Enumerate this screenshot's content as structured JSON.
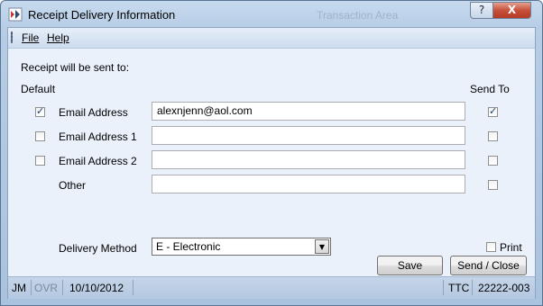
{
  "window": {
    "title": "Receipt Delivery Information",
    "background_title": "Transaction Area",
    "help_button": "?",
    "close_button": "X"
  },
  "menu": {
    "file": "File",
    "help": "Help"
  },
  "form": {
    "intro": "Receipt will be sent to:",
    "default_header": "Default",
    "sendto_header": "Send To",
    "rows": [
      {
        "label": "Email Address",
        "value": "alexnjenn@aol.com",
        "default": true,
        "send_to": true
      },
      {
        "label": "Email Address 1",
        "value": "",
        "default": false,
        "send_to": false
      },
      {
        "label": "Email Address 2",
        "value": "",
        "default": false,
        "send_to": false
      },
      {
        "label": "Other",
        "value": "",
        "send_to": false
      }
    ],
    "delivery_method_label": "Delivery Method",
    "delivery_method_value": "E - Electronic",
    "print_label": "Print",
    "print_checked": false
  },
  "buttons": {
    "save": "Save",
    "send_close": "Send / Close"
  },
  "status": {
    "user": "JM",
    "mode": "OVR",
    "date": "10/10/2012",
    "code": "TTC",
    "number": "22222-003"
  }
}
